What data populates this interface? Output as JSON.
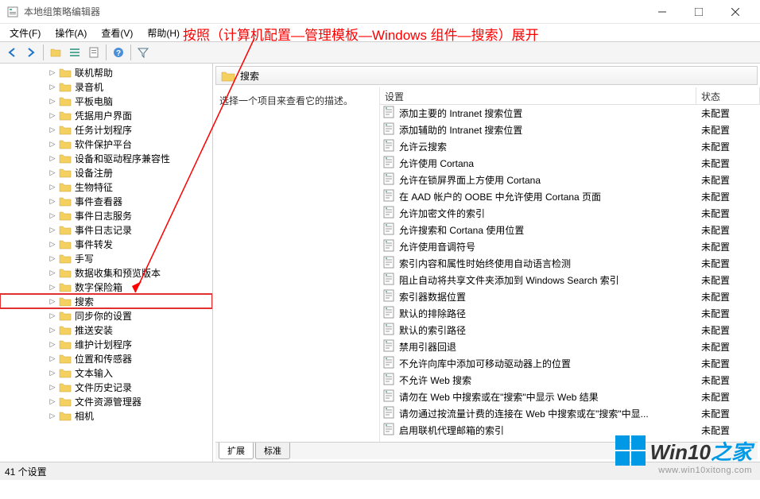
{
  "window": {
    "title": "本地组策略编辑器"
  },
  "menu": {
    "file": "文件(F)",
    "action": "操作(A)",
    "view": "查看(V)",
    "help": "帮助(H)"
  },
  "annotation": "按照（计算机配置—管理模板—Windows 组件—搜索）展开",
  "tree": {
    "items": [
      {
        "label": "联机帮助"
      },
      {
        "label": "录音机"
      },
      {
        "label": "平板电脑"
      },
      {
        "label": "凭据用户界面"
      },
      {
        "label": "任务计划程序"
      },
      {
        "label": "软件保护平台"
      },
      {
        "label": "设备和驱动程序兼容性"
      },
      {
        "label": "设备注册"
      },
      {
        "label": "生物特征"
      },
      {
        "label": "事件查看器"
      },
      {
        "label": "事件日志服务"
      },
      {
        "label": "事件日志记录"
      },
      {
        "label": "事件转发"
      },
      {
        "label": "手写"
      },
      {
        "label": "数据收集和预览版本"
      },
      {
        "label": "数字保险箱"
      },
      {
        "label": "搜索",
        "highlight": true
      },
      {
        "label": "同步你的设置"
      },
      {
        "label": "推送安装"
      },
      {
        "label": "维护计划程序"
      },
      {
        "label": "位置和传感器"
      },
      {
        "label": "文本输入"
      },
      {
        "label": "文件历史记录"
      },
      {
        "label": "文件资源管理器"
      },
      {
        "label": "相机"
      }
    ]
  },
  "content": {
    "header": "搜索",
    "description": "选择一个项目来查看它的描述。",
    "columns": {
      "setting": "设置",
      "state": "状态"
    },
    "rows": [
      {
        "label": "添加主要的 Intranet 搜索位置",
        "state": "未配置"
      },
      {
        "label": "添加辅助的 Intranet 搜索位置",
        "state": "未配置"
      },
      {
        "label": "允许云搜索",
        "state": "未配置"
      },
      {
        "label": "允许使用 Cortana",
        "state": "未配置"
      },
      {
        "label": "允许在锁屏界面上方使用 Cortana",
        "state": "未配置"
      },
      {
        "label": "在 AAD 帐户的 OOBE 中允许使用 Cortana 页面",
        "state": "未配置"
      },
      {
        "label": "允许加密文件的索引",
        "state": "未配置"
      },
      {
        "label": "允许搜索和 Cortana 使用位置",
        "state": "未配置"
      },
      {
        "label": "允许使用音调符号",
        "state": "未配置"
      },
      {
        "label": "索引内容和属性时始终使用自动语言检测",
        "state": "未配置"
      },
      {
        "label": "阻止自动将共享文件夹添加到 Windows Search 索引",
        "state": "未配置"
      },
      {
        "label": "索引器数据位置",
        "state": "未配置"
      },
      {
        "label": "默认的排除路径",
        "state": "未配置"
      },
      {
        "label": "默认的索引路径",
        "state": "未配置"
      },
      {
        "label": "禁用引器回退",
        "state": "未配置"
      },
      {
        "label": "不允许向库中添加可移动驱动器上的位置",
        "state": "未配置"
      },
      {
        "label": "不允许 Web 搜索",
        "state": "未配置"
      },
      {
        "label": "请勿在 Web 中搜索或在\"搜索\"中显示 Web 结果",
        "state": "未配置"
      },
      {
        "label": "请勿通过按流量计费的连接在 Web 中搜索或在\"搜索\"中显...",
        "state": "未配置"
      },
      {
        "label": "启用联机代理邮箱的索引",
        "state": "未配置"
      }
    ],
    "tabs": {
      "extended": "扩展",
      "standard": "标准"
    }
  },
  "statusbar": "41 个设置",
  "watermark": {
    "brand1": "Win10",
    "brand2": "之家",
    "url": "www.win10xitong.com"
  }
}
